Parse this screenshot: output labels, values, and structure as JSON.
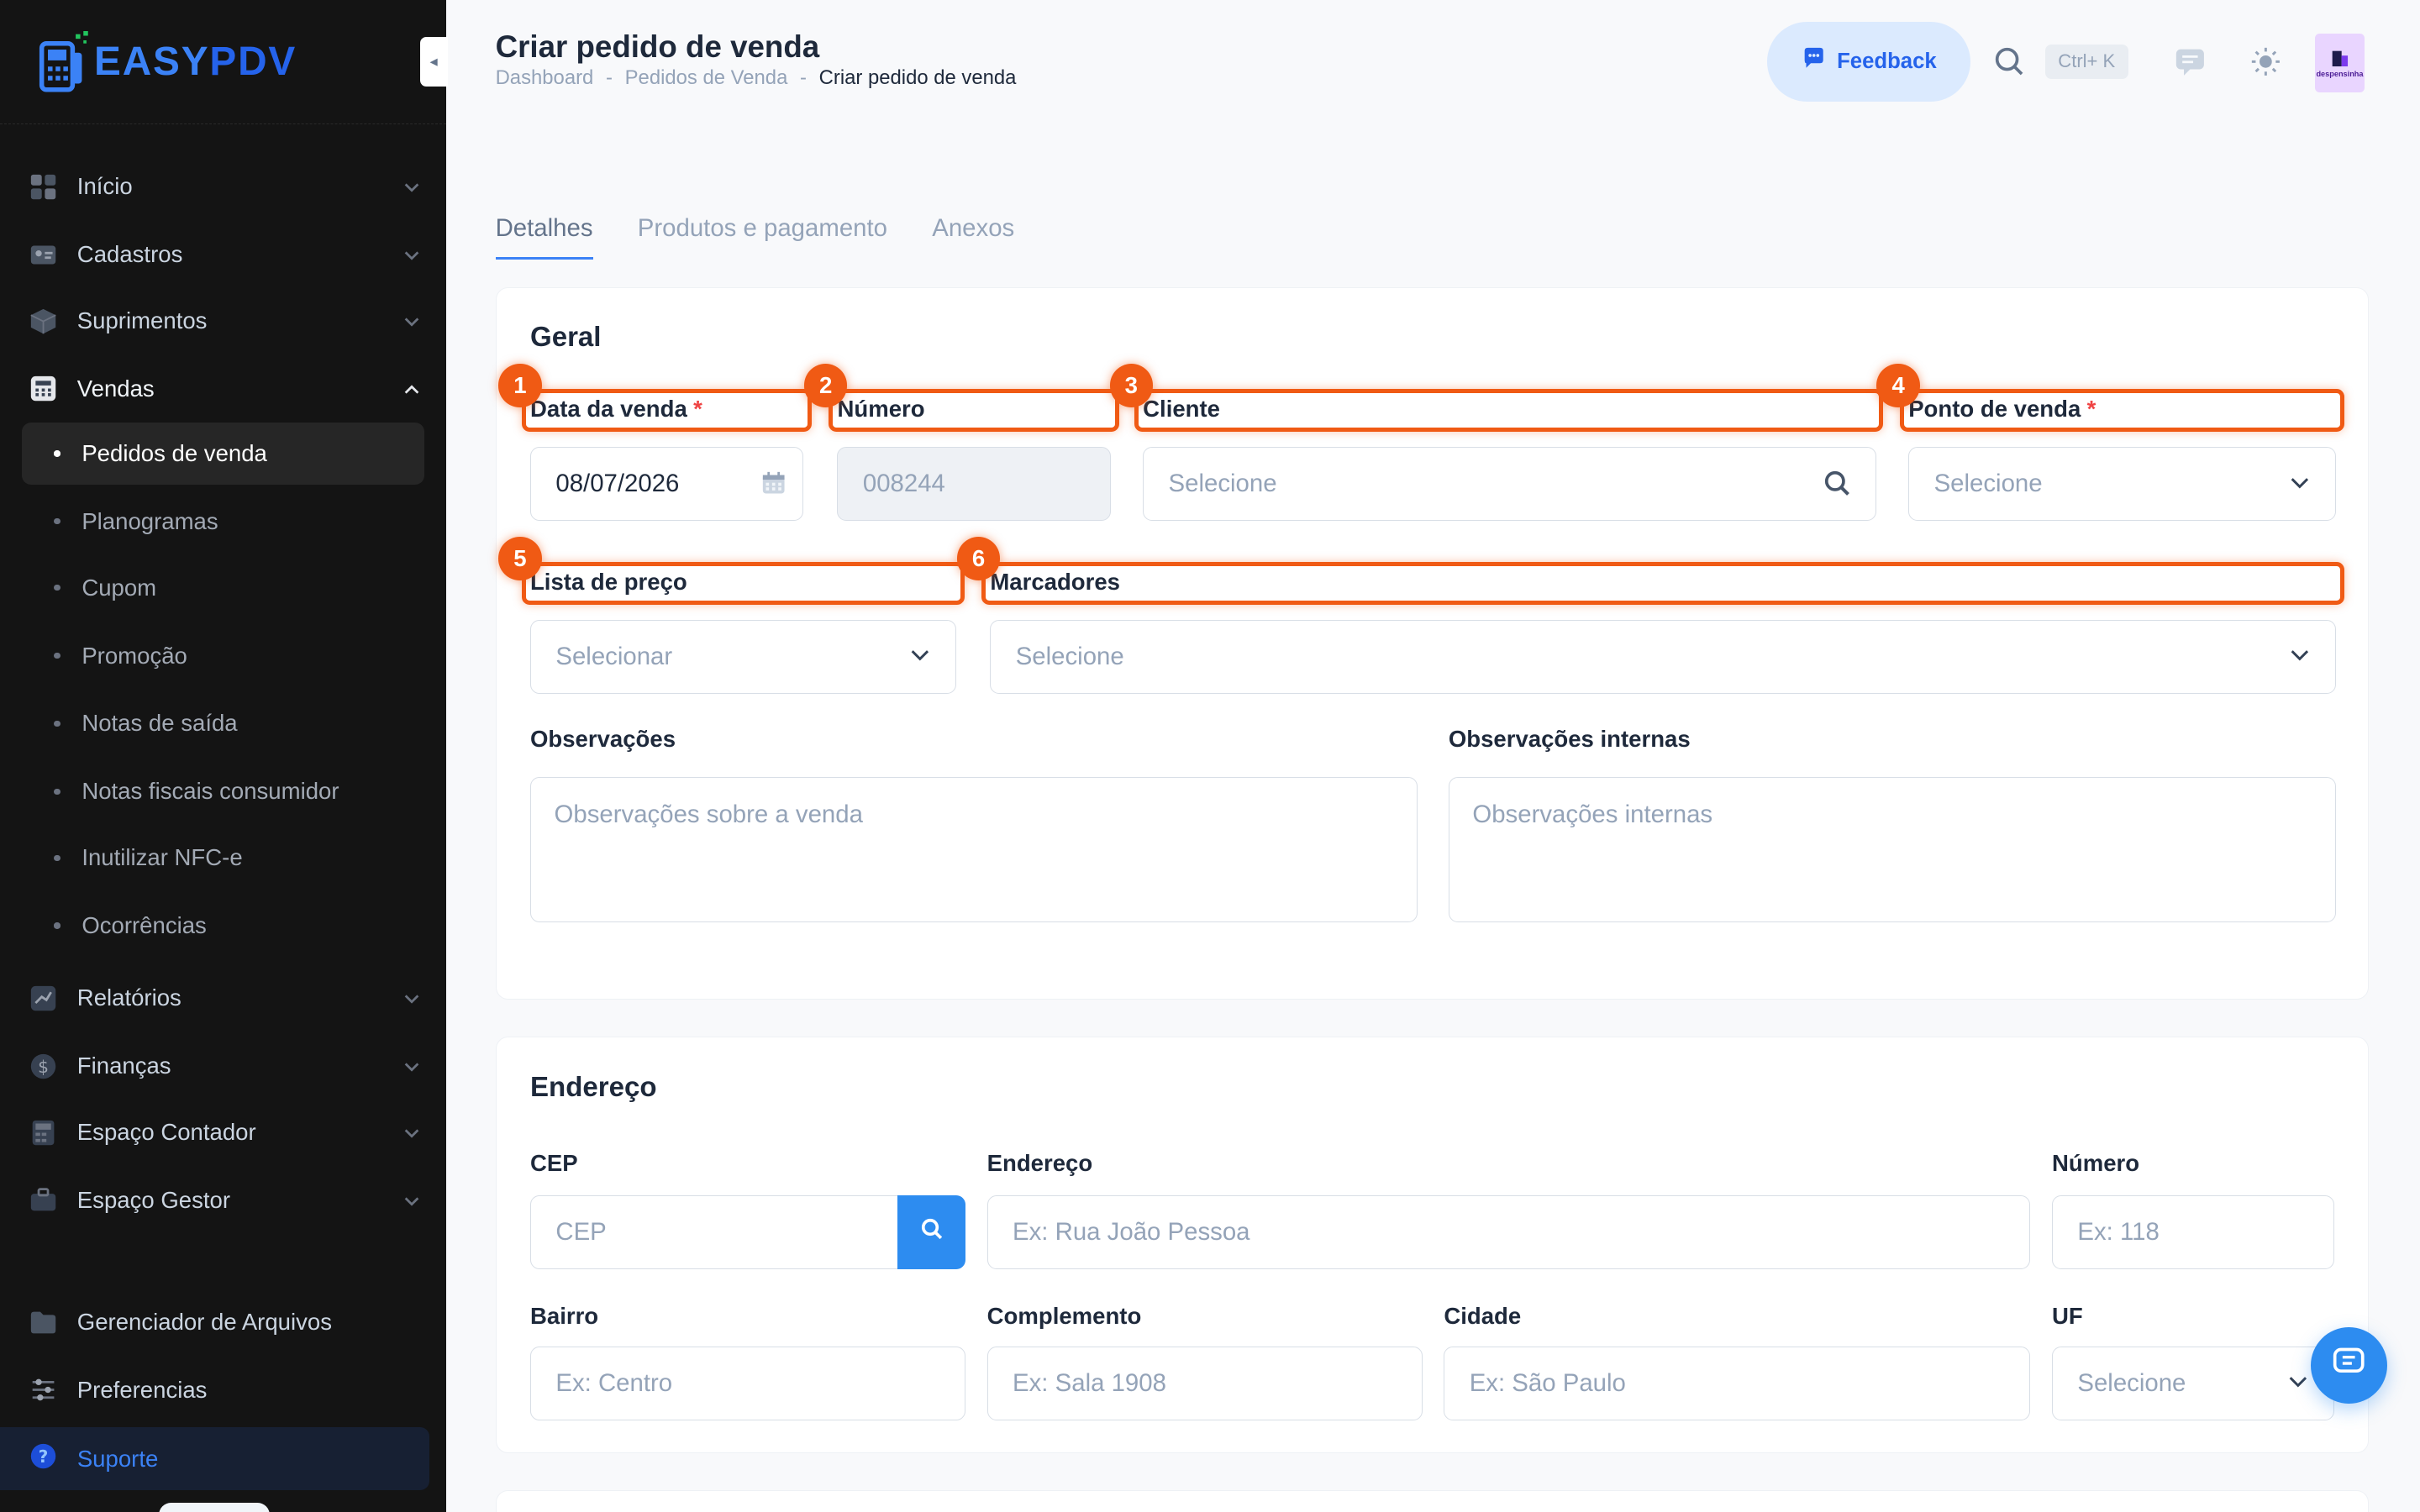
{
  "brand": {
    "logo_easy": "EASY",
    "logo_pdv": "PDV"
  },
  "sidebar": {
    "items": [
      {
        "label": "Início",
        "icon": "grid-icon"
      },
      {
        "label": "Cadastros",
        "icon": "id-card-icon"
      },
      {
        "label": "Suprimentos",
        "icon": "box-icon"
      },
      {
        "label": "Vendas",
        "icon": "register-icon"
      }
    ],
    "sub_items": [
      {
        "label": "Pedidos de venda",
        "active": true
      },
      {
        "label": "Planogramas"
      },
      {
        "label": "Cupom"
      },
      {
        "label": "Promoção"
      },
      {
        "label": "Notas de saída"
      },
      {
        "label": "Notas fiscais consumidor"
      },
      {
        "label": "Inutilizar NFC-e"
      },
      {
        "label": "Ocorrências"
      }
    ],
    "items_after": [
      {
        "label": "Relatórios",
        "icon": "chart-icon"
      },
      {
        "label": "Finanças",
        "icon": "dollar-icon"
      },
      {
        "label": "Espaço Contador",
        "icon": "calculator-icon"
      },
      {
        "label": "Espaço Gestor",
        "icon": "briefcase-icon"
      }
    ],
    "footer_items": [
      {
        "label": "Gerenciador de Arquivos",
        "icon": "folder-icon"
      },
      {
        "label": "Preferencias",
        "icon": "sliders-icon"
      }
    ],
    "support_label": "Suporte"
  },
  "header": {
    "title": "Criar pedido de venda",
    "breadcrumb": [
      "Dashboard",
      "-",
      "Pedidos de Venda",
      "-",
      "Criar pedido de venda"
    ],
    "feedback_label": "Feedback",
    "shortcut": "Ctrl+ K",
    "avatar_text": "despensinha"
  },
  "tabs": [
    "Detalhes",
    "Produtos e pagamento",
    "Anexos"
  ],
  "geral": {
    "title": "Geral",
    "data_venda": {
      "label": "Data da venda",
      "required": "*",
      "value": "08/07/2026"
    },
    "numero": {
      "label": "Número",
      "value": "008244"
    },
    "cliente": {
      "label": "Cliente",
      "placeholder": "Selecione"
    },
    "ponto_venda": {
      "label": "Ponto de venda",
      "required": "*",
      "placeholder": "Selecione"
    },
    "lista_preco": {
      "label": "Lista de preço",
      "placeholder": "Selecionar"
    },
    "marcadores": {
      "label": "Marcadores",
      "placeholder": "Selecione"
    },
    "observacoes": {
      "label": "Observações",
      "placeholder": "Observações sobre a venda"
    },
    "observacoes_internas": {
      "label": "Observações internas",
      "placeholder": "Observações internas"
    }
  },
  "endereco": {
    "title": "Endereço",
    "cep": {
      "label": "CEP",
      "placeholder": "CEP"
    },
    "endereco": {
      "label": "Endereço",
      "placeholder": "Ex: Rua João Pessoa"
    },
    "numero": {
      "label": "Número",
      "placeholder": "Ex: 118"
    },
    "bairro": {
      "label": "Bairro",
      "placeholder": "Ex: Centro"
    },
    "complemento": {
      "label": "Complemento",
      "placeholder": "Ex: Sala 1908"
    },
    "cidade": {
      "label": "Cidade",
      "placeholder": "Ex: São Paulo"
    },
    "uf": {
      "label": "UF",
      "placeholder": "Selecione"
    }
  },
  "annotations": [
    "1",
    "2",
    "3",
    "4",
    "5",
    "6"
  ],
  "colors": {
    "accent": "#2d8cf0",
    "annotation": "#f05a14",
    "sidebar_bg": "#141414"
  }
}
